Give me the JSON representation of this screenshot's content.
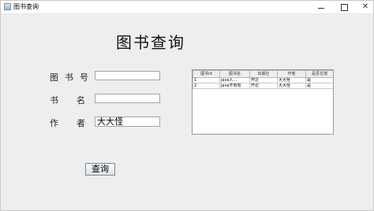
{
  "window": {
    "title": "图书查询"
  },
  "heading": "图书查询",
  "form": {
    "isbn_label": "图书号",
    "book_label_1": "书",
    "book_label_2": "名",
    "author_label_1": "作",
    "author_label_2": "者",
    "isbn_value": "",
    "book_value": "",
    "author_value": "大大怪"
  },
  "query_button": "查询",
  "table": {
    "columns": [
      "图书id",
      "图书名",
      "出版社",
      "作者",
      "是否在馆"
    ],
    "rows": [
      [
        "1",
        "java入...",
        "开达",
        "大大怪",
        "是"
      ],
      [
        "2",
        "java不有有",
        "开达",
        "大大怪",
        "是"
      ]
    ]
  }
}
